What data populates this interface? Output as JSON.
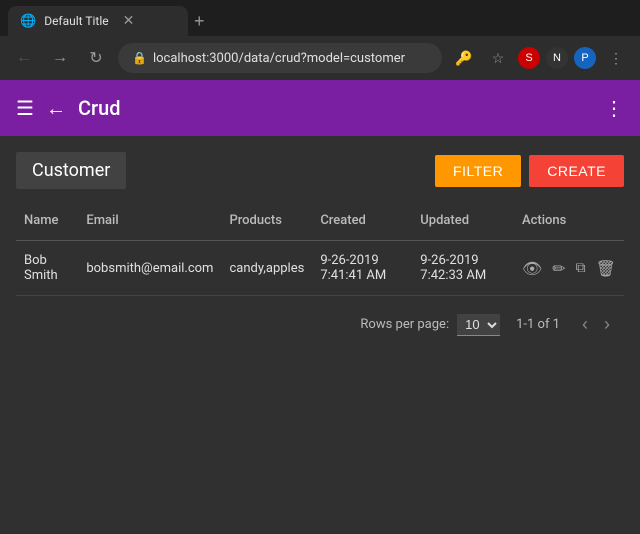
{
  "browser": {
    "tab_title": "Default Title",
    "url": "localhost:3000/data/crud?model=customer",
    "new_tab_icon": "+"
  },
  "app": {
    "menu_icon": "☰",
    "back_icon": "←",
    "title": "Crud",
    "more_icon": "⋮"
  },
  "table": {
    "section_title": "Customer",
    "filter_label": "FILTER",
    "create_label": "CREATE",
    "columns": [
      {
        "key": "name",
        "label": "Name"
      },
      {
        "key": "email",
        "label": "Email"
      },
      {
        "key": "products",
        "label": "Products"
      },
      {
        "key": "created",
        "label": "Created"
      },
      {
        "key": "updated",
        "label": "Updated"
      },
      {
        "key": "actions",
        "label": "Actions"
      }
    ],
    "rows": [
      {
        "name": "Bob Smith",
        "email": "bobsmith@email.com",
        "products": "candy,apples",
        "created": "9-26-2019 7:41:41 AM",
        "updated": "9-26-2019 7:42:33 AM"
      }
    ]
  },
  "pagination": {
    "rows_per_page_label": "Rows per page:",
    "rows_per_page_value": "10",
    "page_info": "1-1 of 1"
  },
  "icons": {
    "eye": "👁",
    "edit": "✏",
    "copy": "⧉",
    "delete": "🗑"
  }
}
